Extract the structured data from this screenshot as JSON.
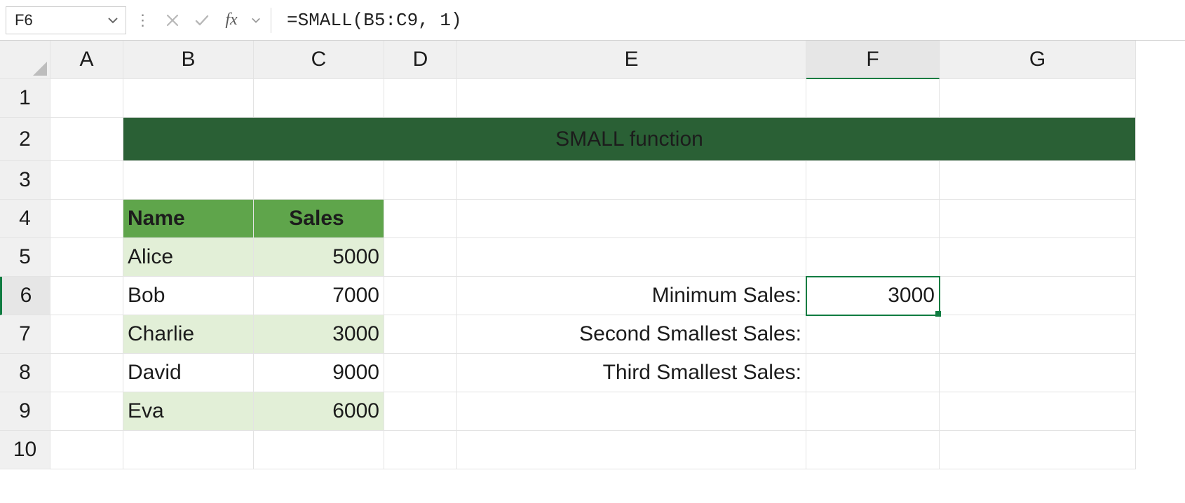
{
  "nameBox": {
    "value": "F6"
  },
  "formulaBar": {
    "formula": "=SMALL(B5:C9, 1)"
  },
  "icons": {
    "cancel": "✕",
    "accept": "✓"
  },
  "columns": [
    "A",
    "B",
    "C",
    "D",
    "E",
    "F",
    "G"
  ],
  "rows": [
    "1",
    "2",
    "3",
    "4",
    "5",
    "6",
    "7",
    "8",
    "9",
    "10"
  ],
  "title": "SMALL function",
  "table": {
    "headers": {
      "name": "Name",
      "sales": "Sales"
    },
    "rows": [
      {
        "name": "Alice",
        "sales": "5000"
      },
      {
        "name": "Bob",
        "sales": "7000"
      },
      {
        "name": "Charlie",
        "sales": "3000"
      },
      {
        "name": "David",
        "sales": "9000"
      },
      {
        "name": "Eva",
        "sales": "6000"
      }
    ]
  },
  "labels": {
    "min": "Minimum Sales:",
    "second": "Second Smallest Sales:",
    "third": "Third Smallest Sales:"
  },
  "results": {
    "min": "3000",
    "second": "",
    "third": ""
  },
  "activeCell": "F6"
}
